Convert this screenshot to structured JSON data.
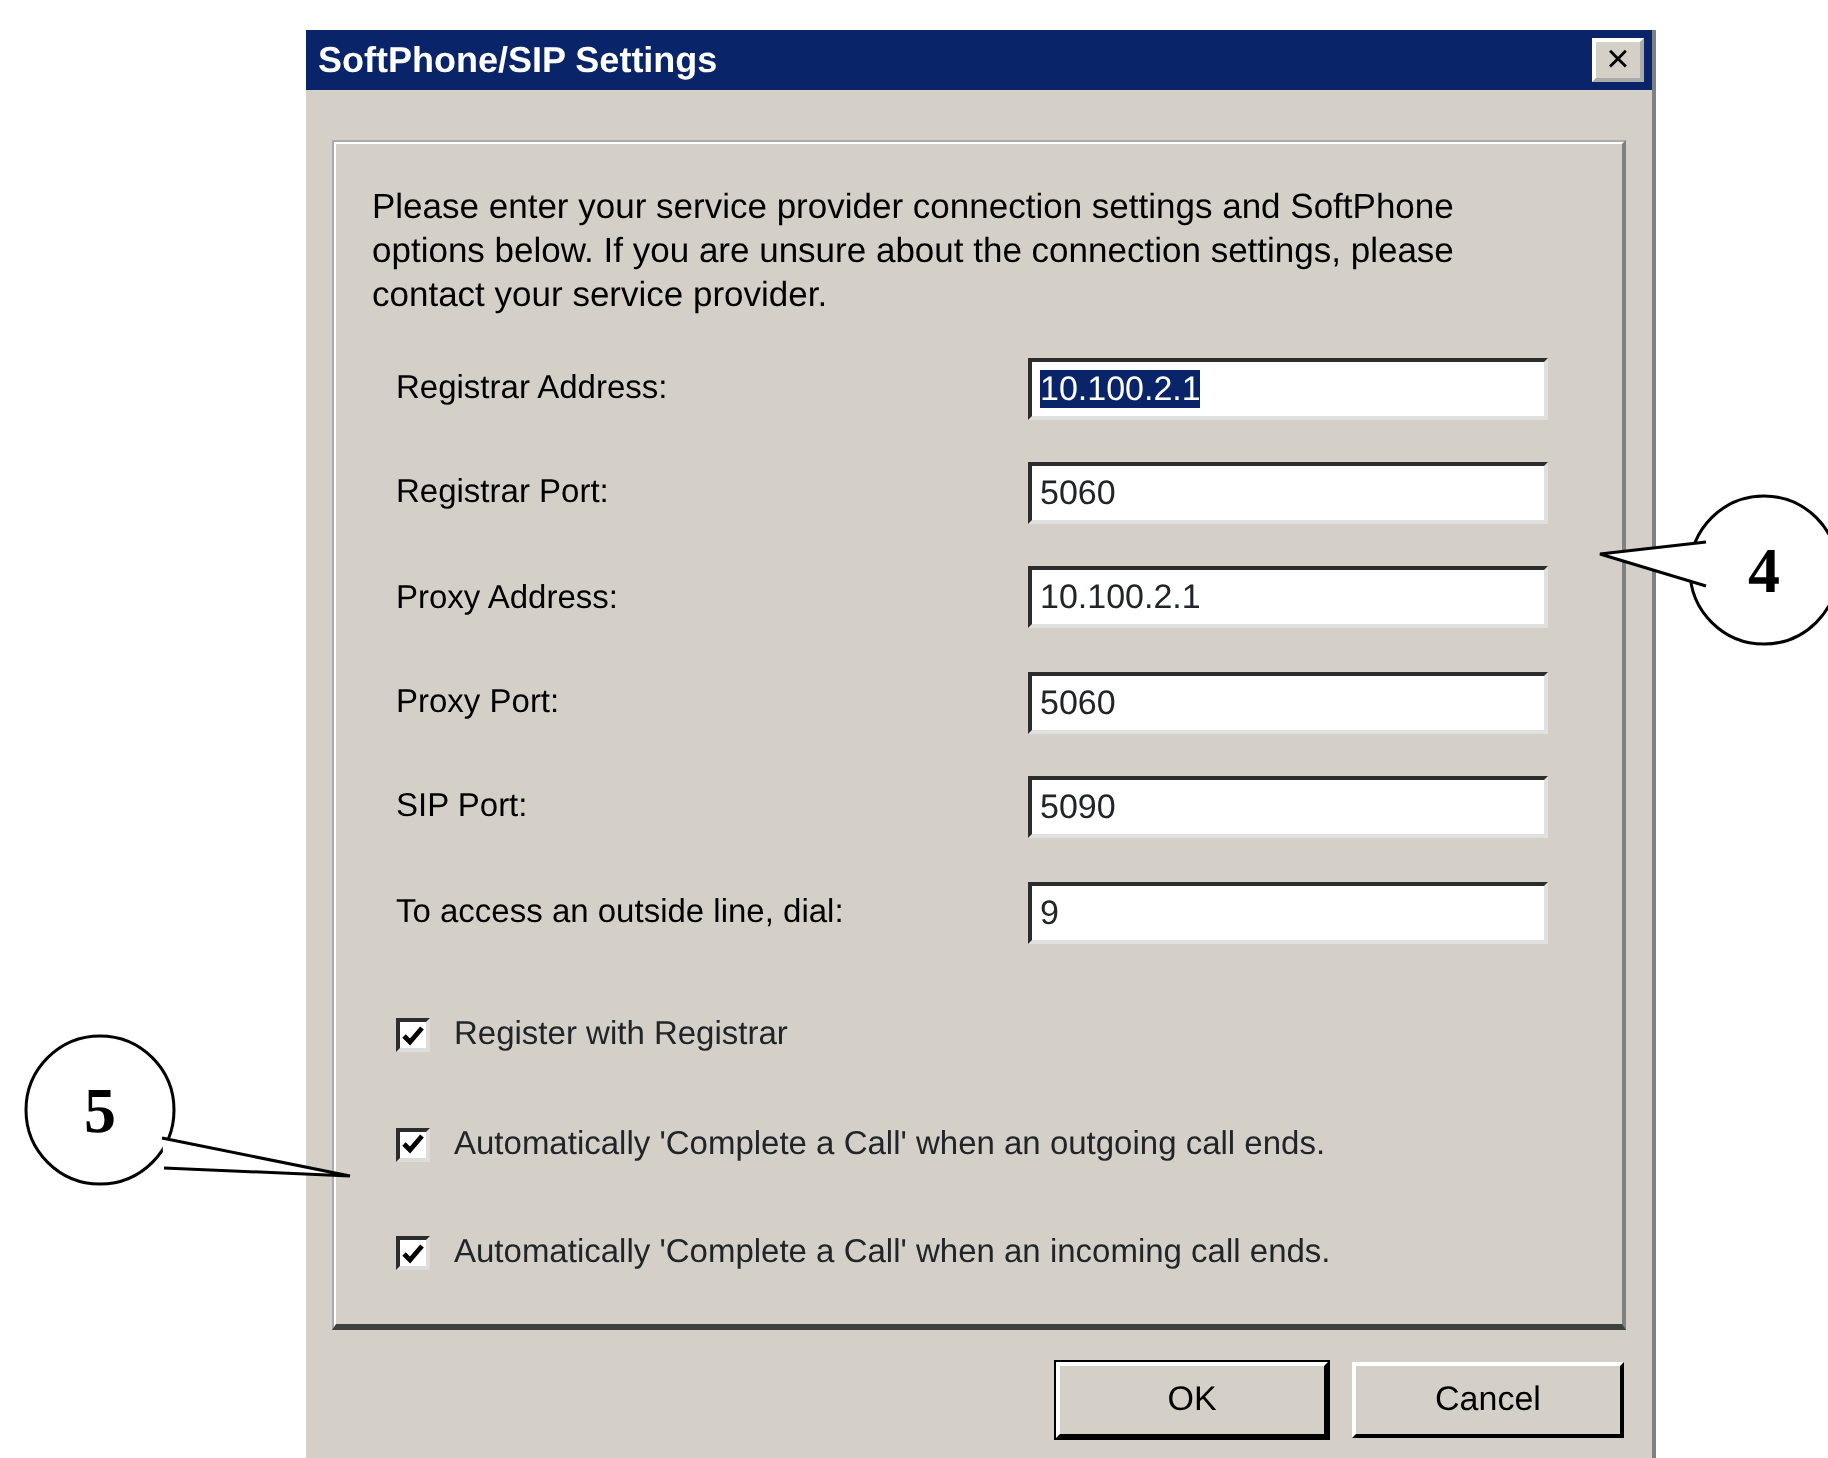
{
  "window": {
    "title": "SoftPhone/SIP Settings",
    "close": "×"
  },
  "intro": "Please enter your service provider connection settings and SoftPhone options below. If you are unsure about the connection settings, please contact your service provider.",
  "fields": [
    {
      "label": "Registrar Address:",
      "value": "10.100.2.1",
      "text_selected": true
    },
    {
      "label": "Registrar Port:",
      "value": "5060",
      "text_selected": false
    },
    {
      "label": "Proxy Address:",
      "value": "10.100.2.1",
      "text_selected": false
    },
    {
      "label": "Proxy Port:",
      "value": "5060",
      "text_selected": false
    },
    {
      "label": "SIP Port:",
      "value": "5090",
      "text_selected": false
    },
    {
      "label": "To access an outside line, dial:",
      "value": "9",
      "text_selected": false
    }
  ],
  "options": [
    {
      "label": "Register with Registrar",
      "checked": true
    },
    {
      "label": "Automatically 'Complete a Call' when an outgoing call ends.",
      "checked": true
    },
    {
      "label": "Automatically 'Complete a Call' when an incoming call ends.",
      "checked": true
    }
  ],
  "buttons": [
    {
      "label": "OK",
      "default": true
    },
    {
      "label": "Cancel",
      "default": false
    }
  ],
  "callouts": [
    {
      "label": "4"
    },
    {
      "label": "5"
    }
  ]
}
